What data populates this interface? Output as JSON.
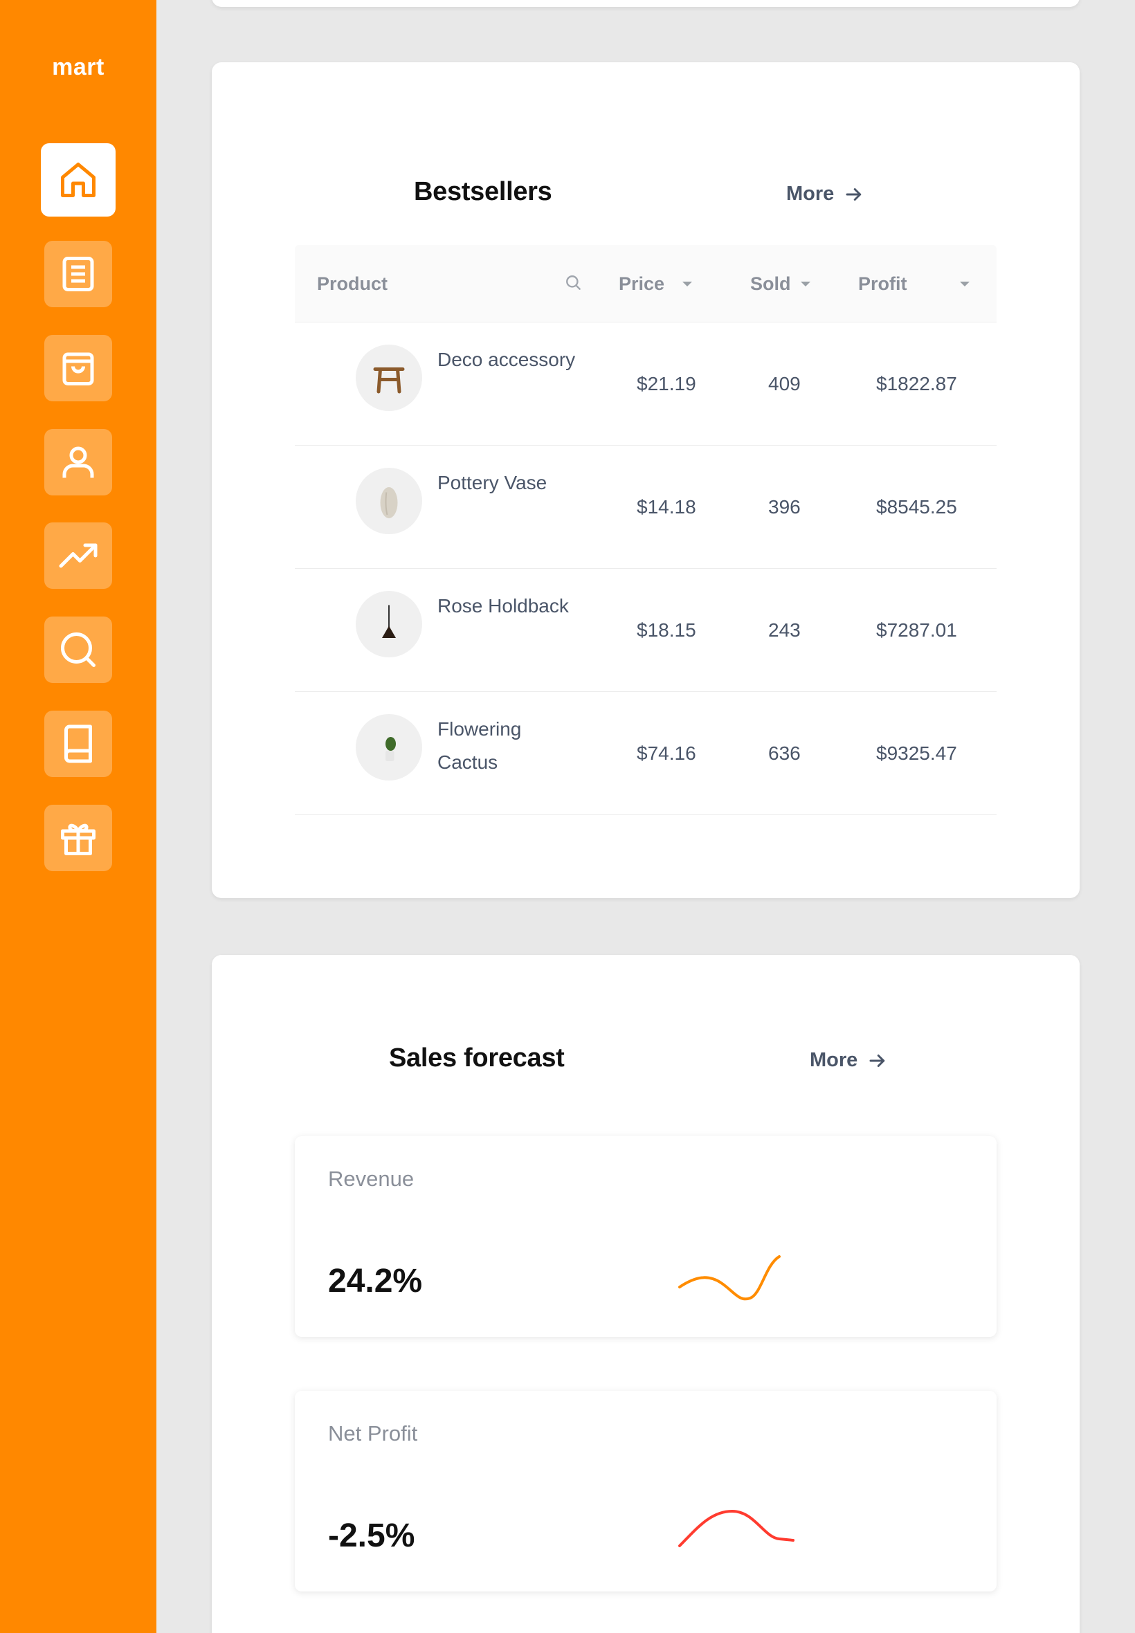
{
  "brand": "mart",
  "nav": [
    {
      "icon": "home-icon",
      "active": true
    },
    {
      "icon": "document-icon",
      "active": false
    },
    {
      "icon": "shopping-bag-icon",
      "active": false
    },
    {
      "icon": "user-icon",
      "active": false
    },
    {
      "icon": "trending-up-icon",
      "active": false
    },
    {
      "icon": "search-icon",
      "active": false
    },
    {
      "icon": "book-icon",
      "active": false
    },
    {
      "icon": "gift-icon",
      "active": false
    }
  ],
  "colors": {
    "accent": "#ff8800",
    "revenue": "#ff8c00",
    "profit": "#ff3b2f"
  },
  "bestsellers": {
    "title": "Bestsellers",
    "more_label": "More",
    "columns": {
      "product": "Product",
      "price": "Price",
      "sold": "Sold",
      "profit": "Profit"
    },
    "rows": [
      {
        "name": "Deco accessory",
        "price": "$21.19",
        "sold": "409",
        "profit": "$1822.87",
        "thumb": "stool-icon"
      },
      {
        "name": "Pottery Vase",
        "price": "$14.18",
        "sold": "396",
        "profit": "$8545.25",
        "thumb": "vase-icon"
      },
      {
        "name": "Rose Holdback",
        "price": "$18.15",
        "sold": "243",
        "profit": "$7287.01",
        "thumb": "lamp-icon"
      },
      {
        "name": "Flowering Cactus",
        "price": "$74.16",
        "sold": "636",
        "profit": "$9325.47",
        "thumb": "cactus-icon"
      }
    ]
  },
  "sales": {
    "title": "Sales forecast",
    "more_label": "More",
    "revenue": {
      "label": "Revenue",
      "value": "24.2%"
    },
    "net_profit": {
      "label": "Net Profit",
      "value": "-2.5%"
    }
  }
}
